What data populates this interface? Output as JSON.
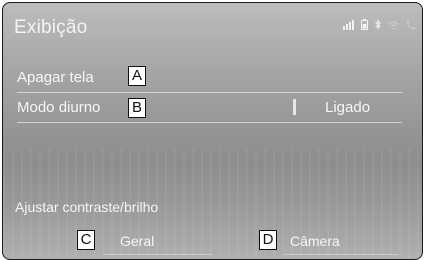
{
  "screen": {
    "title": "Exibição",
    "status_icons": [
      "signal-icon",
      "battery-icon",
      "bluetooth-icon",
      "wifi-icon",
      "phone-icon"
    ]
  },
  "settings": {
    "screen_off_label": "Apagar tela",
    "day_mode_label": "Modo diurno",
    "day_mode_value": "Ligado",
    "contrast_section_label": "Ajustar contraste/brilho",
    "general_button_label": "Geral",
    "camera_button_label": "Câmera"
  },
  "callouts": {
    "a": "A",
    "b": "B",
    "c": "C",
    "d": "D"
  },
  "colors": {
    "text": "#f6f6f6",
    "background_top": "#bcbcbc",
    "background_mid": "#8d8d8d",
    "callout_fill": "#ffffff",
    "callout_border": "#111111"
  }
}
